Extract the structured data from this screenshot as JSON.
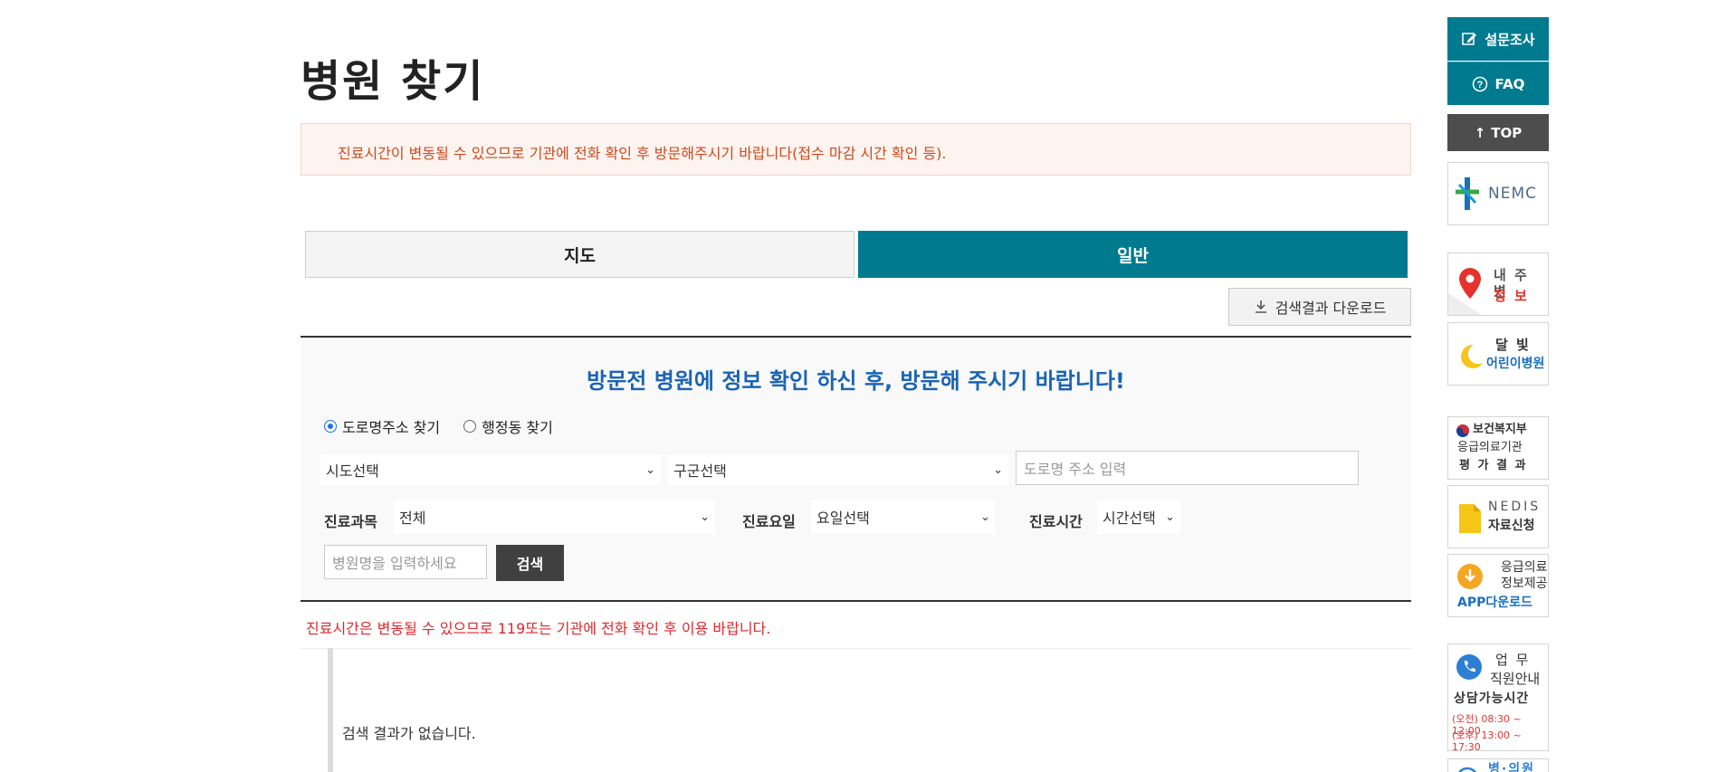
{
  "page": {
    "title": "병원 찾기",
    "notice": "진료시간이 변동될 수 있으므로 기관에 전화 확인 후 방문해주시기 바랍니다(접수 마감 시간 확인 등)."
  },
  "tabs": [
    {
      "label": "지도",
      "active": false
    },
    {
      "label": "일반",
      "active": true
    }
  ],
  "download_label": "검색결과 다운로드",
  "search": {
    "heading": "방문전 병원에 정보 확인 하신 후, 방문해 주시기 바랍니다!",
    "radios": [
      {
        "label": "도로명주소 찾기",
        "checked": true
      },
      {
        "label": "행정동 찾기",
        "checked": false
      }
    ],
    "sido_select": "시도선택",
    "gugun_select": "구군선택",
    "road_placeholder": "도로명 주소 입력",
    "dept_label": "진료과목",
    "dept_value": "전체",
    "day_label": "진료요일",
    "day_value": "요일선택",
    "time_label": "진료시간",
    "time_value": "시간선택",
    "name_placeholder": "병원명을 입력하세요",
    "search_button": "검색"
  },
  "result": {
    "red_notice": "진료시간은 변동될 수 있으므로 119또는 기관에 전화 확인 후 이용 바랍니다.",
    "empty": "검색 결과가 없습니다."
  },
  "rail": {
    "survey": "설문조사",
    "faq": "FAQ",
    "top": "TOP",
    "nemc": "NEMC",
    "nearby": {
      "line1": "내 주 변",
      "line2": "정  보"
    },
    "moonlight": {
      "line1": "달    빛",
      "line2": "어린이병원"
    },
    "mohw": {
      "line1": "보건복지부",
      "line2": "응급의료기관",
      "line3": "평 가 결 과"
    },
    "nedis": {
      "line1": "NEDIS",
      "line2": "자료신청"
    },
    "app": {
      "line1": "응급의료",
      "line2": "정보제공",
      "line3": "APP다운로드"
    },
    "contact": {
      "line1": "업    무",
      "line2": "직원안내",
      "line3": "상담가능시간",
      "line4": "(오전) 08:30 ~ 12:00",
      "line5": "(오후) 13:00 ~ 17:30"
    },
    "last_partial": "병·의원"
  },
  "colors": {
    "teal": "#007a8f",
    "heading_blue": "#1a64b4",
    "notice_red": "#e0262b",
    "notice_orange": "#cc4a1f",
    "dark": "#404040"
  }
}
